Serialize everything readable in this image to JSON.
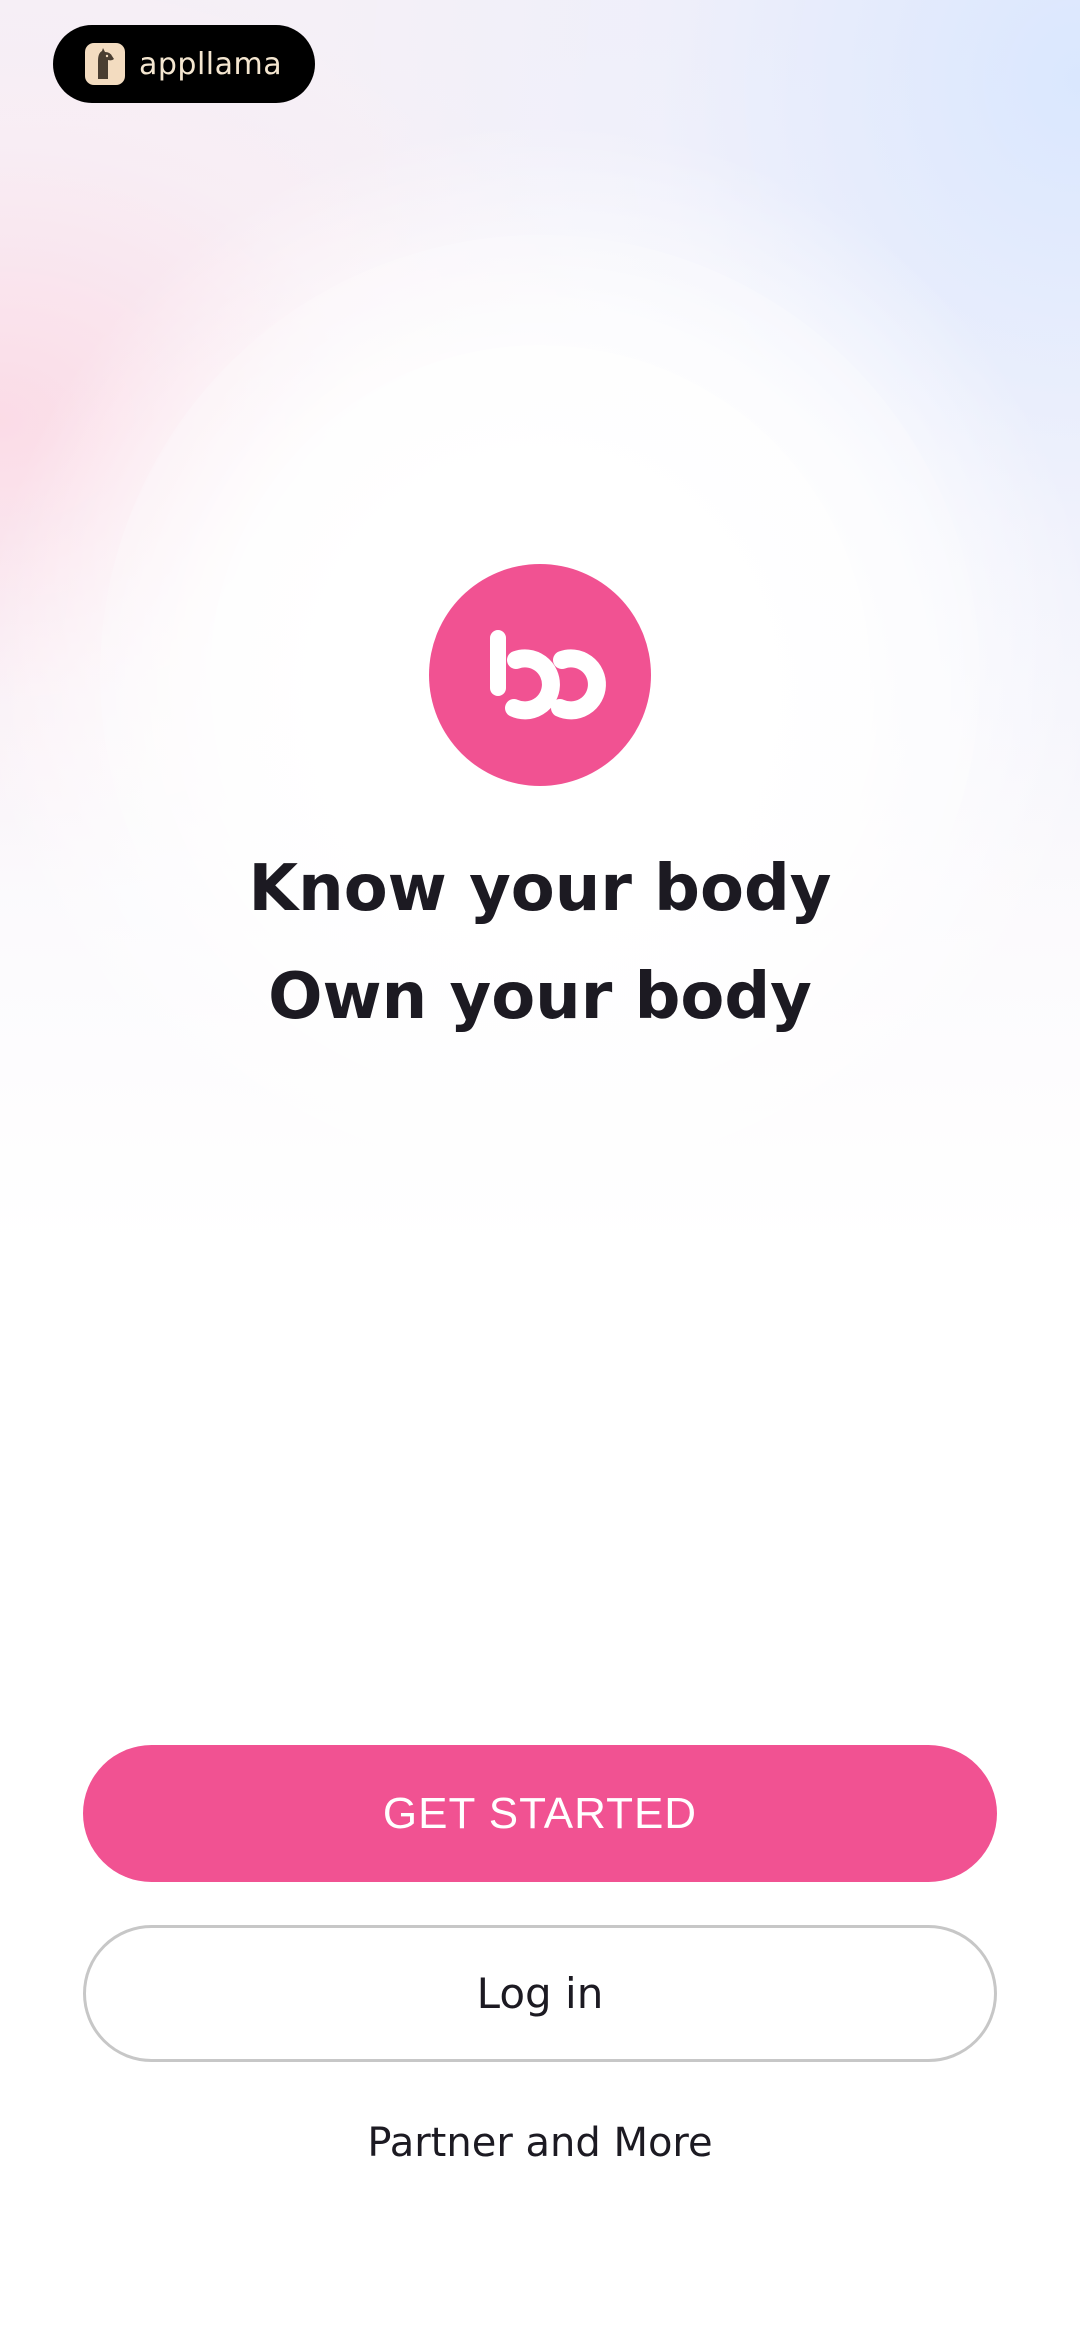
{
  "badge": {
    "name": "appllama",
    "icon": "llama-icon"
  },
  "brand": {
    "accent": "#f15292",
    "logo_icon": "bb-logo-icon"
  },
  "headline": {
    "line1": "Know your body",
    "line2": "Own your body"
  },
  "actions": {
    "get_started": "GET STARTED",
    "login": "Log in",
    "partner": "Partner and More"
  }
}
